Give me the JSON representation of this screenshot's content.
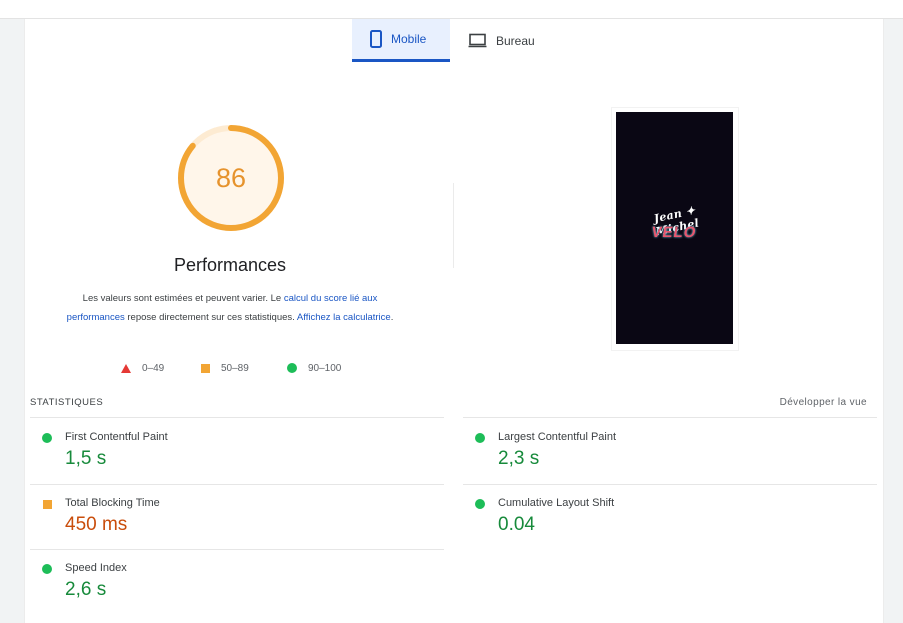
{
  "tabs": {
    "mobile": "Mobile",
    "desktop": "Bureau"
  },
  "score": {
    "value": "86",
    "fraction": 0.86,
    "title": "Performances",
    "color": "#f2a534"
  },
  "description": {
    "part1": "Les valeurs sont estimées et peuvent varier. Le ",
    "link1": "calcul du score lié aux performances",
    "part2": " repose directement sur ces statistiques. ",
    "link2": "Affichez la calculatrice",
    "part3": "."
  },
  "legend": [
    {
      "range": "0–49",
      "shape": "triangle",
      "color": "#e53935"
    },
    {
      "range": "50–89",
      "shape": "square",
      "color": "#f2a534"
    },
    {
      "range": "90–100",
      "shape": "circle",
      "color": "#1dbd58"
    }
  ],
  "screenshot": {
    "logo_line1": "Jean ✦ Michel",
    "logo_line2": "VELO"
  },
  "stats": {
    "header": "STATISTIQUES",
    "expand": "Développer la vue",
    "metrics": [
      {
        "label": "First Contentful Paint",
        "value": "1,5 s",
        "status": "good"
      },
      {
        "label": "Largest Contentful Paint",
        "value": "2,3 s",
        "status": "good"
      },
      {
        "label": "Total Blocking Time",
        "value": "450 ms",
        "status": "average"
      },
      {
        "label": "Cumulative Layout Shift",
        "value": "0.04",
        "status": "good"
      },
      {
        "label": "Speed Index",
        "value": "2,6 s",
        "status": "good"
      }
    ]
  }
}
